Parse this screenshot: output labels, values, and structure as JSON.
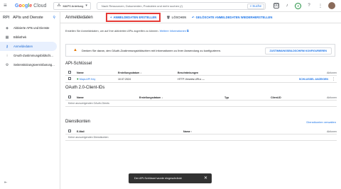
{
  "topbar": {
    "menu_icon": "≡",
    "logo_google": "Google",
    "logo_cloud": "Cloud",
    "project_icon": "⁂",
    "project": "MAPS Anleitung",
    "search_placeholder": "Nach Ressourcen, Dokumenten, Produkten und mehr suchen (/)",
    "search_button": "Suche",
    "badge": "3"
  },
  "sidebar": {
    "rpi": "RPI",
    "title": "APIs und Dienste",
    "pin": "📌",
    "items": [
      {
        "label": "Aktivierte APIs und Dienste",
        "icon": "◈"
      },
      {
        "label": "Bibliothek",
        "icon": "▦"
      },
      {
        "label": "Anmeldedaten",
        "icon": "⚷"
      },
      {
        "label": "OAuth-Zustimmungsbildschi...",
        "icon": "⁝"
      },
      {
        "label": "Seitenstützungsvereinbarung...",
        "icon": "⚙"
      }
    ],
    "collapse": "⇤"
  },
  "actionbar": {
    "title": "Anmeldedaten",
    "create": "ANMELDEDATEN ERSTELLEN",
    "delete": "LÖSCHEN",
    "restore": "GELÖSCHTE ANMELDEDATEN WIEDERHERSTELLEN"
  },
  "intro": {
    "text": "Erstellen Sie Anmeldedaten, um auf Ihre aktivierten APIs zugreifen zu können.",
    "link1": "Weitere",
    "link2": "Informationen"
  },
  "info": {
    "text": "Denken Sie daran, den OAuth-Zustimmungsbildschirm mit Informationen zu Ihrer Anwendung zu konfigurieren.",
    "button": "ZUSTIMMUNGSBILDSCHIRM KONFIGURIEREN"
  },
  "api_keys": {
    "title": "API-Schlüssel",
    "headers": [
      "Name",
      "Erstellungsdatum",
      "Beschränkungen",
      "Aktionen"
    ],
    "row": {
      "name": "Maps API Key",
      "date": "10.07.2024",
      "restrictions": "HTTP-Verweis-URLs",
      "dash": "—",
      "action": "SCHLÜSSEL ANZEIGEN"
    }
  },
  "oauth": {
    "title": "OAuth 2.0-Client-IDs",
    "headers": [
      "Name",
      "Erstellungsdatum",
      "Typ",
      "Client-ID",
      "Aktionen"
    ],
    "empty": "Keine anzuzeigenden OAuth-Clients"
  },
  "service": {
    "title": "Dienstkonten",
    "manage": "Dienstkonten verwalten",
    "headers": [
      "E-Mail",
      "Name",
      "Aktionen"
    ],
    "empty": "Keine anzuzeigenden Dienstkonten"
  },
  "snackbar": {
    "text": "Der API-Schlüssel wurde eingeschränkt",
    "close": "✕"
  }
}
